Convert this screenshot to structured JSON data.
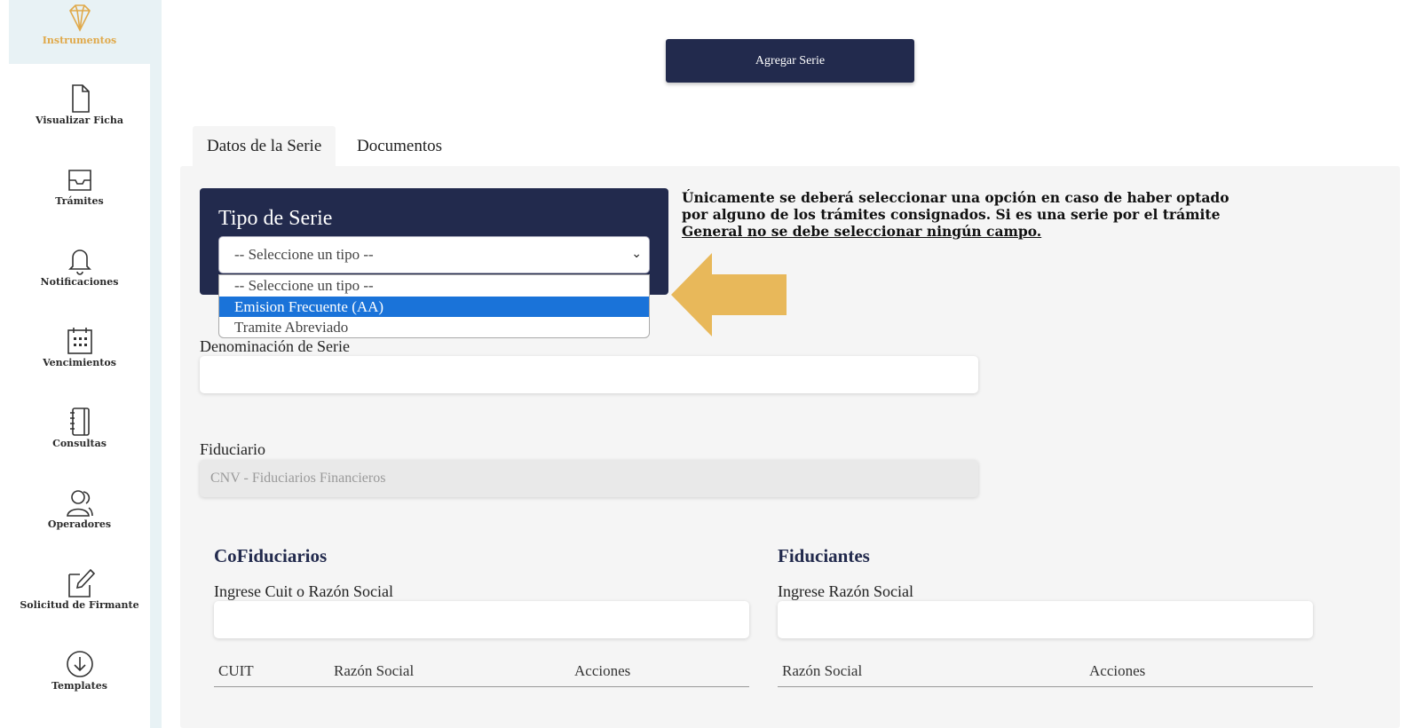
{
  "sidebar": {
    "items": [
      {
        "label": "Instrumentos",
        "icon": "diamond-icon",
        "active": true
      },
      {
        "label": "Visualizar Ficha",
        "icon": "file-icon"
      },
      {
        "label": "Trámites",
        "icon": "inbox-icon"
      },
      {
        "label": "Notificaciones",
        "icon": "bell-icon"
      },
      {
        "label": "Vencimientos",
        "icon": "calendar-icon"
      },
      {
        "label": "Consultas",
        "icon": "notebook-icon"
      },
      {
        "label": "Operadores",
        "icon": "users-icon"
      },
      {
        "label": "Solicitud de Firmante",
        "icon": "edit-icon"
      },
      {
        "label": "Templates",
        "icon": "download-icon"
      }
    ]
  },
  "toolbar": {
    "add_serie_label": "Agregar Serie"
  },
  "tabs": [
    {
      "label": "Datos de la Serie",
      "active": true
    },
    {
      "label": "Documentos"
    }
  ],
  "tipo_serie": {
    "title": "Tipo de Serie",
    "selected": "-- Seleccione un tipo --",
    "options": [
      "-- Seleccione un tipo --",
      "Emision Frecuente (AA)",
      "Tramite Abreviado"
    ]
  },
  "notice": {
    "text": "Únicamente se deberá seleccionar una opción en caso de haber optado por alguno de los trámites consignados. Si es una serie por el trámite ",
    "underlined": "General no se debe seleccionar ningún campo."
  },
  "denominacion": {
    "label": "Denominación de Serie",
    "value": ""
  },
  "fiduciario": {
    "label": "Fiduciario",
    "value": "CNV - Fiduciarios Financieros"
  },
  "cofiduciarios": {
    "title": "CoFiduciarios",
    "search_label": "Ingrese Cuit o Razón Social",
    "columns": [
      "CUIT",
      "Razón Social",
      "Acciones"
    ]
  },
  "fiduciantes": {
    "title": "Fiduciantes",
    "search_label": "Ingrese Razón Social",
    "columns": [
      "Razón Social",
      "Acciones"
    ]
  },
  "colors": {
    "navy": "#222a4d",
    "accent": "#e0a94a",
    "highlight": "#1a73d9",
    "arrow": "#e8b85a"
  }
}
